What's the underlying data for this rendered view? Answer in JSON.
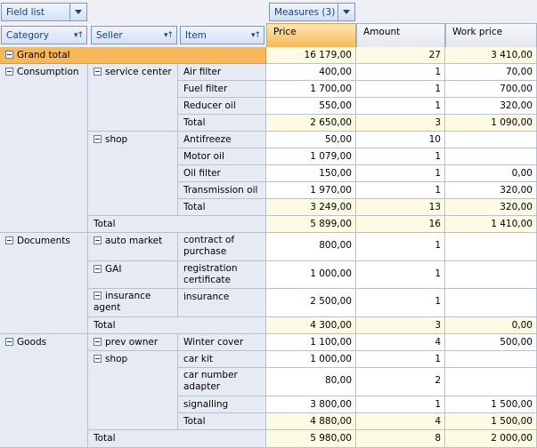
{
  "toolbar": {
    "field_list_label": "Field list",
    "measures_label": "Measures (3)"
  },
  "row_headers": {
    "category": "Category",
    "seller": "Seller",
    "item": "Item"
  },
  "measures": {
    "price": "Price",
    "amount": "Amount",
    "work_price": "Work price"
  },
  "grand_total": {
    "label": "Grand total",
    "price": "16 179,00",
    "amount": "27",
    "work": "3 410,00"
  },
  "total_label": "Total",
  "categories": [
    {
      "name": "Consumption",
      "sellers": [
        {
          "name": "service center",
          "items": [
            {
              "name": "Air filter",
              "price": "400,00",
              "amount": "1",
              "work": "70,00"
            },
            {
              "name": "Fuel filter",
              "price": "1 700,00",
              "amount": "1",
              "work": "700,00"
            },
            {
              "name": "Reducer oil",
              "price": "550,00",
              "amount": "1",
              "work": "320,00"
            }
          ],
          "total": {
            "price": "2 650,00",
            "amount": "3",
            "work": "1 090,00"
          }
        },
        {
          "name": "shop",
          "items": [
            {
              "name": "Antifreeze",
              "price": "50,00",
              "amount": "10",
              "work": ""
            },
            {
              "name": "Motor oil",
              "price": "1 079,00",
              "amount": "1",
              "work": ""
            },
            {
              "name": "Oil filter",
              "price": "150,00",
              "amount": "1",
              "work": "0,00"
            },
            {
              "name": "Transmission oil",
              "price": "1 970,00",
              "amount": "1",
              "work": "320,00"
            }
          ],
          "total": {
            "price": "3 249,00",
            "amount": "13",
            "work": "320,00"
          }
        }
      ],
      "total": {
        "price": "5 899,00",
        "amount": "16",
        "work": "1 410,00"
      }
    },
    {
      "name": "Documents",
      "sellers": [
        {
          "name": "auto market",
          "items": [
            {
              "name": "contract of purchase",
              "price": "800,00",
              "amount": "1",
              "work": ""
            }
          ]
        },
        {
          "name": "GAI",
          "items": [
            {
              "name": "registration certificate",
              "price": "1 000,00",
              "amount": "1",
              "work": ""
            }
          ]
        },
        {
          "name": "insurance agent",
          "items": [
            {
              "name": "insurance",
              "price": "2 500,00",
              "amount": "1",
              "work": ""
            }
          ]
        }
      ],
      "total": {
        "price": "4 300,00",
        "amount": "3",
        "work": "0,00"
      }
    },
    {
      "name": "Goods",
      "sellers": [
        {
          "name": "prev owner",
          "items": [
            {
              "name": "Winter cover",
              "price": "1 100,00",
              "amount": "4",
              "work": "500,00"
            }
          ]
        },
        {
          "name": "shop",
          "items": [
            {
              "name": "car kit",
              "price": "1 000,00",
              "amount": "1",
              "work": ""
            },
            {
              "name": "car number adapter",
              "price": "80,00",
              "amount": "2",
              "work": ""
            },
            {
              "name": "signalling",
              "price": "3 800,00",
              "amount": "1",
              "work": "1 500,00"
            }
          ],
          "total": {
            "price": "4 880,00",
            "amount": "4",
            "work": "1 500,00"
          }
        }
      ],
      "total": {
        "price": "5 980,00",
        "amount": "8",
        "work": "2 000,00"
      }
    }
  ]
}
